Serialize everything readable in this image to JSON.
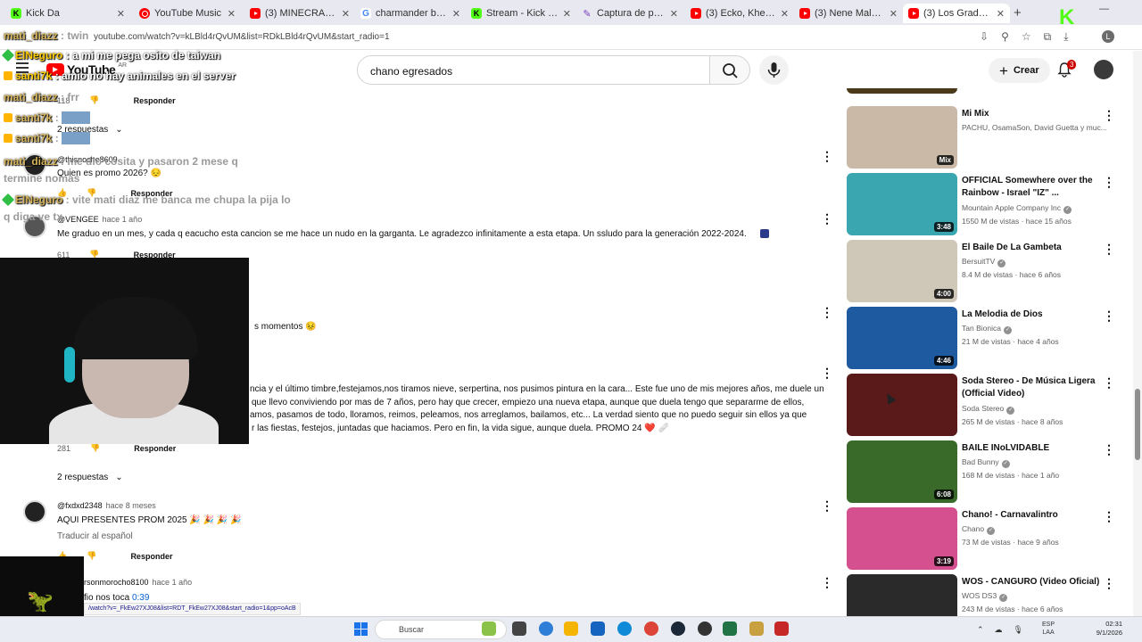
{
  "browser": {
    "tabs": [
      {
        "label": "Kick Da",
        "icon": "kick",
        "active": false
      },
      {
        "label": "YouTube Music",
        "icon": "ytmusic",
        "active": false
      },
      {
        "label": "(3) MINECRAFT RAP",
        "icon": "youtube",
        "active": false
      },
      {
        "label": "charmander badge p",
        "icon": "google",
        "active": false
      },
      {
        "label": "Stream - Kick Dashb",
        "icon": "kick",
        "active": false
      },
      {
        "label": "Captura de pantalla",
        "icon": "pen",
        "active": false
      },
      {
        "label": "(3) Ecko, Khea, Seven",
        "icon": "youtube",
        "active": false
      },
      {
        "label": "(3) Nene Malo - Es u",
        "icon": "youtube",
        "active": false
      },
      {
        "label": "(3) Los Graduados -",
        "icon": "youtube",
        "active": true
      }
    ],
    "url": "youtube.com/watch?v=kLBld4rQvUM&list=RDkLBld4rQvUM&start_radio=1",
    "status_url": "/watch?v=_FkEw27XJ08&list=RDT_FkEw27XJ08&start_radio=1&pp=oAcB"
  },
  "youtube": {
    "logo_text": "YouTube",
    "region": "AR",
    "search_value": "chano egresados",
    "create_label": "Crear",
    "notifications": "3"
  },
  "comments": {
    "reply_label": "Responder",
    "c0": {
      "likes": "118"
    },
    "c1": {
      "replies": "2 respuestas"
    },
    "c2": {
      "author": "@thisnoche8609",
      "text": "Quien es promo 2026?",
      "likes": "",
      "emoji": "😔"
    },
    "c3": {
      "author": "@VENGEE",
      "time": "hace 1 año",
      "text": "Me graduo en un mes, y cada q eacucho esta cancion se me hace un nudo en la garganta. Le agradezco infinitamente a esta etapa. Un ssludo para la generación 2022-2024.",
      "likes": "611"
    },
    "c4": {
      "text_partial": "s momentos"
    },
    "c5": {
      "line1": "ncia y el último timbre,festejamos,nos tiramos nieve, serpertina, nos pusimos pintura en la cara... Este fue uno de mis mejores años, me duele un",
      "line2": "que llevo conviviendo por mas de 7 años, pero hay que crecer, empiezo una nueva etapa, aunque que duela tengo que separarme de ellos,",
      "line3": "amos, pasamos de todo, lloramos, reimos, peleamos, nos arreglamos, bailamos, etc... La verdad siento que no puedo seguir sin ellos ya que",
      "line4": "r las fiestas, festejos, juntadas que haciamos. Pero en fin, la vida sigue, aunque duela. PROMO 24",
      "likes": "281",
      "replies": "2 respuestas"
    },
    "c6": {
      "author": "@fxdxd2348",
      "time": "hace 8 meses",
      "text": "AQUI PRESENTES PROM 2025",
      "translate": "Traducir al español"
    },
    "c7": {
      "author": "rsonmorocho8100",
      "time": "hace 1 año",
      "text": "fio nos toca",
      "timestamp": "0:39"
    }
  },
  "chat": [
    {
      "user": "ElNeguro",
      "msg": "a mi me pega osito de taiwan"
    },
    {
      "user": "santi7k",
      "msg": "amio no hay animales en el server"
    },
    {
      "user": "mati_diazz",
      "msg": "twin"
    },
    {
      "user": "mati_diazz",
      "msg": "frr"
    },
    {
      "user": "santi7k",
      "msg": ""
    },
    {
      "user": "santi7k",
      "msg": ""
    },
    {
      "user": "mati_diazz",
      "msg": "me dio cosita y pasaron 2 mese q termine nomas"
    },
    {
      "user": "ElNeguro",
      "msg": "vite mati diaz me banca me chupa la pija lo q diga ve tx"
    }
  ],
  "sidebar": {
    "videos": [
      {
        "title": "Mi Mix",
        "channel": "PACHU, OsamaSon, David Guetta y muc...",
        "meta": "",
        "duration": "Mix",
        "thumb": "#c9b9a6",
        "verified": false
      },
      {
        "title": "OFFICIAL Somewhere over the Rainbow - Israel \"IZ\" ...",
        "channel": "Mountain Apple Company Inc",
        "meta": "1550 M de vistas · hace 15 años",
        "duration": "3:48",
        "thumb": "#3aa7b0",
        "verified": true
      },
      {
        "title": "El Baile De La Gambeta",
        "channel": "BersuitTV",
        "meta": "8.4 M de vistas · hace 6 años",
        "duration": "4:00",
        "thumb": "#cfc7b7",
        "verified": true
      },
      {
        "title": "La Melodia de Dios",
        "channel": "Tan Bionica",
        "meta": "21 M de vistas · hace 4 años",
        "duration": "4:46",
        "thumb": "#1e5aa0",
        "verified": true
      },
      {
        "title": "Soda Stereo - De Música Ligera (Official Video)",
        "channel": "Soda Stereo",
        "meta": "265 M de vistas · hace 8 años",
        "duration": "",
        "thumb": "#5a1a1a",
        "verified": true
      },
      {
        "title": "BAILE INoLVIDABLE",
        "channel": "Bad Bunny",
        "meta": "168 M de vistas · hace 1 año",
        "duration": "6:08",
        "thumb": "#3a6a2a",
        "verified": true
      },
      {
        "title": "Chano! - Carnavalintro",
        "channel": "Chano",
        "meta": "73 M de vistas · hace 9 años",
        "duration": "3:19",
        "thumb": "#d4508e",
        "verified": true
      },
      {
        "title": "WOS - CANGURO (Video Oficial)",
        "channel": "WOS DS3",
        "meta": "243 M de vistas · hace 6 años",
        "duration": "",
        "thumb": "#2a2a2a",
        "verified": true
      }
    ]
  },
  "taskbar": {
    "search_placeholder": "Buscar",
    "lang1": "ESP",
    "lang2": "LAA",
    "time": "02:31",
    "date": "9/1/2026"
  },
  "overlay": {
    "kick_logo": "K"
  }
}
